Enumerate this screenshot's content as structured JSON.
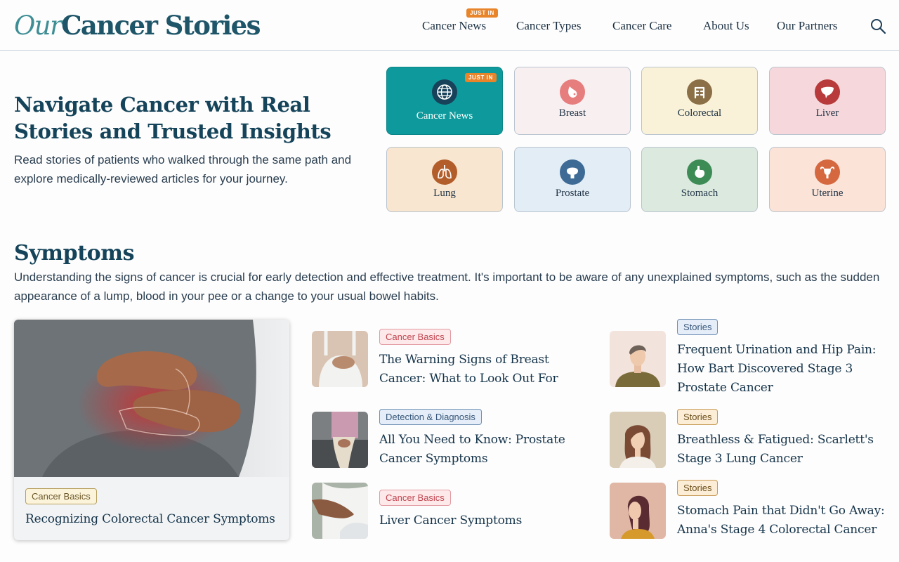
{
  "header": {
    "logo_our": "Our",
    "logo_rest": "Cancer Stories",
    "nav": [
      "Cancer News",
      "Cancer Types",
      "Cancer Care",
      "About Us",
      "Our Partners"
    ],
    "nav_badge": "JUST IN"
  },
  "hero": {
    "title": "Navigate Cancer with Real Stories and Trusted Insights",
    "subtitle": "Read stories of patients who walked through the same path and explore medically-reviewed articles for your journey.",
    "tiles": [
      {
        "label": "Cancer News",
        "icon": "globe-icon",
        "badge": "JUST IN"
      },
      {
        "label": "Breast",
        "icon": "breast-icon"
      },
      {
        "label": "Colorectal",
        "icon": "colon-icon"
      },
      {
        "label": "Liver",
        "icon": "liver-icon"
      },
      {
        "label": "Lung",
        "icon": "lungs-icon"
      },
      {
        "label": "Prostate",
        "icon": "prostate-icon"
      },
      {
        "label": "Stomach",
        "icon": "stomach-icon"
      },
      {
        "label": "Uterine",
        "icon": "uterus-icon"
      }
    ]
  },
  "symptoms": {
    "title": "Symptoms",
    "description": "Understanding the signs of cancer is crucial for early detection and effective treatment. It's important to be aware of any unexplained symptoms, such as the sudden appearance of a lump, blood in your pee or a change to your usual bowel habits.",
    "featured": {
      "tag": "Cancer Basics",
      "title": "Recognizing Colorectal Cancer Symptoms"
    },
    "articles": [
      {
        "tag": "Cancer Basics",
        "title": "The Warning Signs of Breast Cancer: What to Look Out For"
      },
      {
        "tag": "Detection & Diagnosis",
        "title": "All You Need to Know: Prostate Cancer Symptoms"
      },
      {
        "tag": "Cancer Basics",
        "title": "Liver Cancer Symptoms"
      }
    ],
    "stories": [
      {
        "tag": "Stories",
        "title": "Frequent Urination and Hip Pain: How Bart Discovered Stage 3 Prostate Cancer"
      },
      {
        "tag": "Stories",
        "title": "Breathless & Fatigued: Scarlett's Stage 3 Lung Cancer"
      },
      {
        "tag": "Stories",
        "title": "Stomach Pain that Didn't Go Away: Anna's Stage 4 Colorectal Cancer"
      }
    ]
  },
  "colors": {
    "brand_teal": "#0e9a9c",
    "heading": "#15445a",
    "badge_orange": "#e8842a"
  }
}
